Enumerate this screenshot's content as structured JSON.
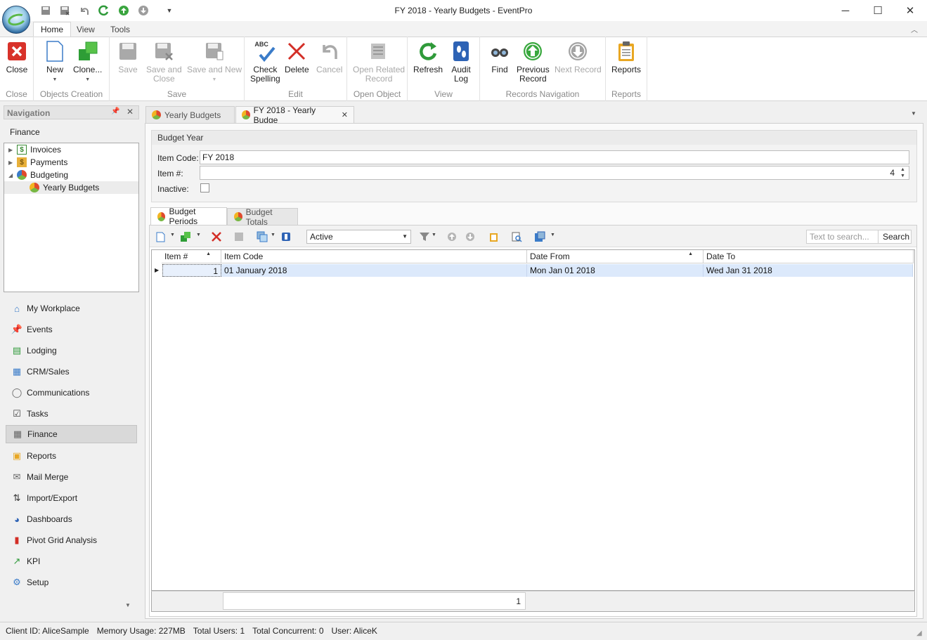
{
  "window": {
    "title": "FY 2018 - Yearly Budgets - EventPro",
    "minimize": "─",
    "maximize": "☐",
    "close": "✕"
  },
  "ribbon": {
    "tabs": [
      "Home",
      "View",
      "Tools"
    ],
    "groups": {
      "close": {
        "label": "Close",
        "buttons": {
          "close": "Close"
        }
      },
      "objects": {
        "label": "Objects Creation",
        "buttons": {
          "new": "New",
          "clone": "Clone..."
        }
      },
      "save": {
        "label": "Save",
        "buttons": {
          "save": "Save",
          "save_close_1": "Save and",
          "save_close_2": "Close",
          "save_new": "Save and New"
        }
      },
      "edit": {
        "label": "Edit",
        "buttons": {
          "check_1": "Check",
          "check_2": "Spelling",
          "delete": "Delete",
          "cancel": "Cancel"
        }
      },
      "open_object": {
        "label": "Open Object",
        "buttons": {
          "open_related_1": "Open Related",
          "open_related_2": "Record"
        }
      },
      "view": {
        "label": "View",
        "buttons": {
          "refresh": "Refresh",
          "audit_1": "Audit",
          "audit_2": "Log"
        }
      },
      "records_nav": {
        "label": "Records Navigation",
        "buttons": {
          "find": "Find",
          "previous_1": "Previous",
          "previous_2": "Record",
          "next": "Next Record"
        }
      },
      "reports": {
        "label": "Reports",
        "buttons": {
          "reports": "Reports"
        }
      }
    },
    "check_icon_text": "ABC"
  },
  "navigation": {
    "header": "Navigation",
    "section": "Finance",
    "tree": [
      "Invoices",
      "Payments",
      "Budgeting",
      "Yearly Budgets"
    ],
    "items": [
      "My Workplace",
      "Events",
      "Lodging",
      "CRM/Sales",
      "Communications",
      "Tasks",
      "Finance",
      "Reports",
      "Mail Merge",
      "Import/Export",
      "Dashboards",
      "Pivot Grid Analysis",
      "KPI",
      "Setup"
    ]
  },
  "doc_tabs": [
    "Yearly Budgets",
    "FY 2018 - Yearly Budge"
  ],
  "budget_year": {
    "header": "Budget Year",
    "item_code_label": "Item Code:",
    "item_code_value": "FY 2018",
    "item_num_label": "Item #:",
    "item_num_value": "4",
    "inactive_label": "Inactive:"
  },
  "sub_tabs": [
    "Budget Periods",
    "Budget Totals"
  ],
  "grid": {
    "filter": "Active",
    "search_placeholder": "Text to search...",
    "search_button": "Search",
    "columns": [
      "Item #",
      "Item Code",
      "Date From",
      "Date To"
    ],
    "rows": [
      {
        "item_num": "1",
        "item_code": "01 January 2018",
        "date_from": "Mon Jan 01 2018",
        "date_to": "Wed Jan 31 2018"
      }
    ],
    "footer_count": "1"
  },
  "status": {
    "client": "Client ID: AliceSample",
    "memory": "Memory Usage: 227MB",
    "users": "Total Users: 1",
    "concurrent": "Total Concurrent: 0",
    "user": "User: AliceK"
  }
}
